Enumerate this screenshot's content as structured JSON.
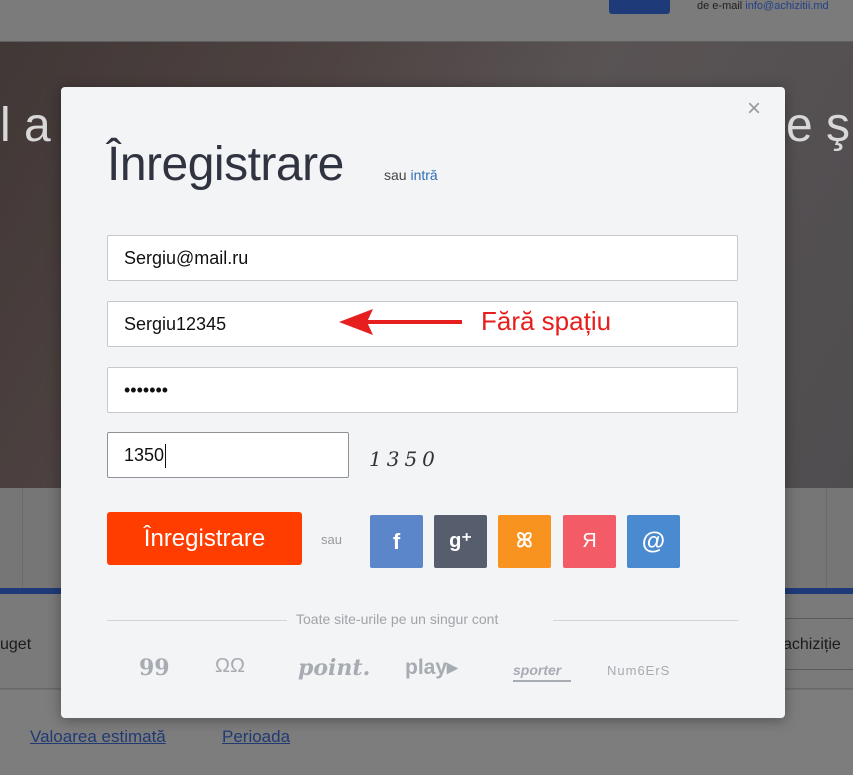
{
  "background": {
    "contact_prefix": "de e-mail ",
    "contact_email": "info@achizitii.md",
    "hero_text_left": "l a",
    "hero_text_right": "e şi",
    "filter_left": "uget",
    "filter_right": "achiziție",
    "links": [
      "Valoarea estimată",
      "Perioada"
    ]
  },
  "modal": {
    "close_icon": "×",
    "title": "Înregistrare",
    "or_text": "sau",
    "login_link": "intră",
    "fields": {
      "email": "Sergiu@mail.ru",
      "username": "Sergiu12345",
      "password": "•••••••",
      "captcha": "1350"
    },
    "captcha_image_text": "1350",
    "annotation": "Fără spațiu",
    "submit_label": "Înregistrare",
    "or_social": "sau",
    "social": [
      {
        "name": "facebook",
        "glyph": "f",
        "color": "#5b86c9"
      },
      {
        "name": "google-plus",
        "glyph": "g⁺",
        "color": "#565e6d"
      },
      {
        "name": "odnoklassniki",
        "glyph": "ꕤ",
        "color": "#f7931e"
      },
      {
        "name": "yandex",
        "glyph": "Я",
        "color": "#f35b67"
      },
      {
        "name": "mail",
        "glyph": "@",
        "color": "#4a8ad1"
      }
    ],
    "divider_text": "Toate site-urile pe un singur cont",
    "logos": [
      "99",
      "ΩΩ",
      "point.",
      "play▸",
      "sporter",
      "Num6ErS"
    ]
  }
}
